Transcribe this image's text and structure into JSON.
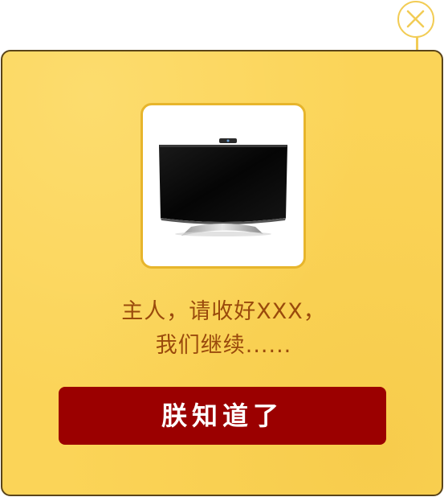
{
  "dialog": {
    "close_icon": "close-icon",
    "product_image": "tv-image",
    "message_line1": "主人，请收好XXX，",
    "message_line2": "我们继续......",
    "confirm_label": "朕知道了"
  },
  "colors": {
    "dialog_background": "#fbd458",
    "dialog_border": "#5a4418",
    "accent_gold": "#f2cc55",
    "message_text": "#9a4a0c",
    "button_background": "#9b0000",
    "button_text": "#ffffff"
  }
}
